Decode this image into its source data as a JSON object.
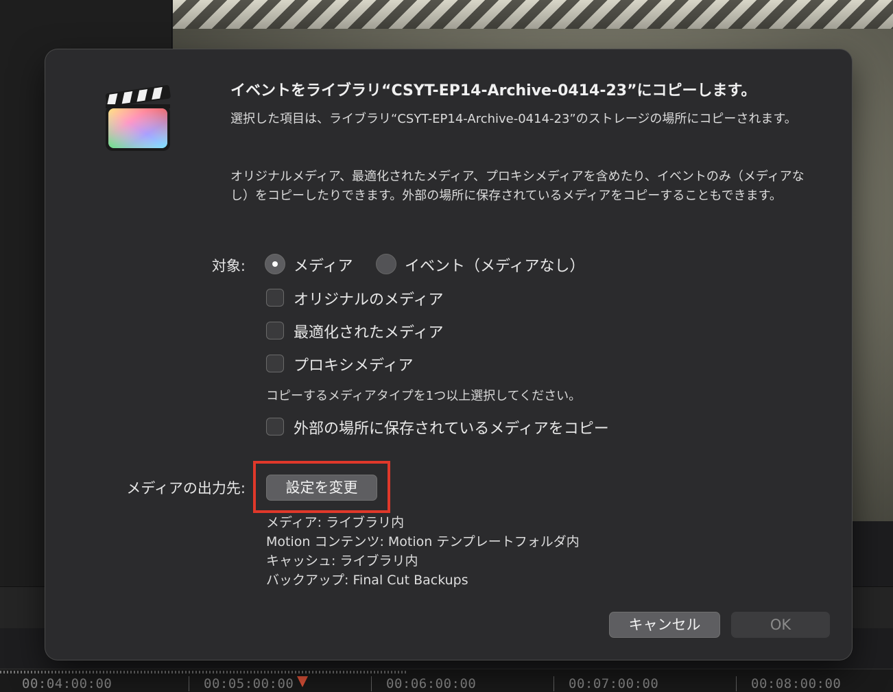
{
  "dialog": {
    "title": "イベントをライブラリ“CSYT-EP14-Archive-0414-23”にコピーします。",
    "paragraph1": "選択した項目は、ライブラリ“CSYT-EP14-Archive-0414-23”のストレージの場所にコピーされます。",
    "paragraph2": "オリジナルメディア、最適化されたメディア、プロキシメディアを含めたり、イベントのみ（メディアなし）をコピーしたりできます。外部の場所に保存されているメディアをコピーすることもできます。",
    "target_label": "対象:",
    "radio_media": "メディア",
    "radio_event_only": "イベント（メディアなし）",
    "check_original": "オリジナルのメディア",
    "check_optimized": "最適化されたメディア",
    "check_proxy": "プロキシメディア",
    "hint": "コピーするメディアタイプを1つ以上選択してください。",
    "check_external": "外部の場所に保存されているメディアをコピー",
    "destination_label": "メディアの出力先:",
    "change_settings_button": "設定を変更",
    "info_media": "メディア: ライブラリ内",
    "info_motion": "Motion コンテンツ: Motion テンプレートフォルダ内",
    "info_cache": "キャッシュ: ライブラリ内",
    "info_backup": "バックアップ: Final Cut Backups",
    "cancel_button": "キャンセル",
    "ok_button": "OK",
    "selected_radio": "メディア"
  },
  "timeline": {
    "timecodes": [
      "00:04:00:00",
      "00:05:00:00",
      "00:06:00:00",
      "00:07:00:00",
      "00:08:00:00"
    ]
  },
  "colors": {
    "highlight": "#e0382a",
    "dialog_bg": "#2b2b2d"
  }
}
